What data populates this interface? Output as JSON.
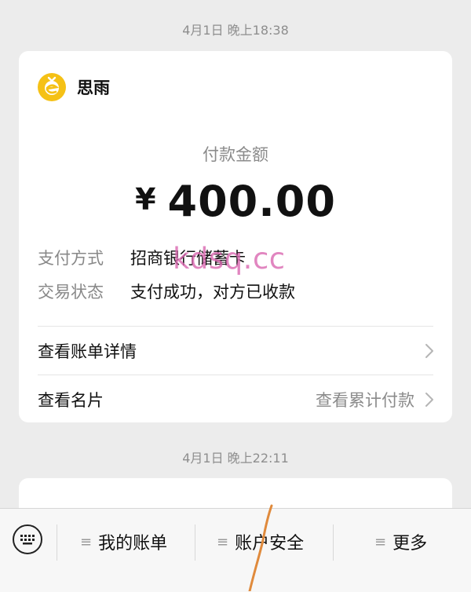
{
  "messages": [
    {
      "timestamp": "4月1日 晚上18:38",
      "card": {
        "merchant_name": "思雨",
        "amount_label": "付款金额",
        "currency_symbol": "¥",
        "amount": "400.00",
        "details": [
          {
            "key": "支付方式",
            "value": "招商银行储蓄卡"
          },
          {
            "key": "交易状态",
            "value": "支付成功，对方已收款"
          }
        ],
        "links": [
          {
            "label": "查看账单详情",
            "hint": ""
          },
          {
            "label": "查看名片",
            "hint": "查看累计付款"
          }
        ]
      }
    },
    {
      "timestamp": "4月1日 晚上22:11"
    }
  ],
  "watermark": "kdsq.cc",
  "bottom_menu": {
    "items": [
      {
        "label": "我的账单"
      },
      {
        "label": "账户安全"
      },
      {
        "label": "更多"
      }
    ]
  },
  "icons": {
    "merchant_logo": "merchant-logo-icon",
    "keyboard": "keyboard-icon",
    "chevron": "chevron-right-icon",
    "menu": "menu-list-icon"
  },
  "colors": {
    "background": "#ececec",
    "logo": "#f5c116",
    "watermark": "#da68b0",
    "annotation_stroke": "#e08a3c"
  }
}
